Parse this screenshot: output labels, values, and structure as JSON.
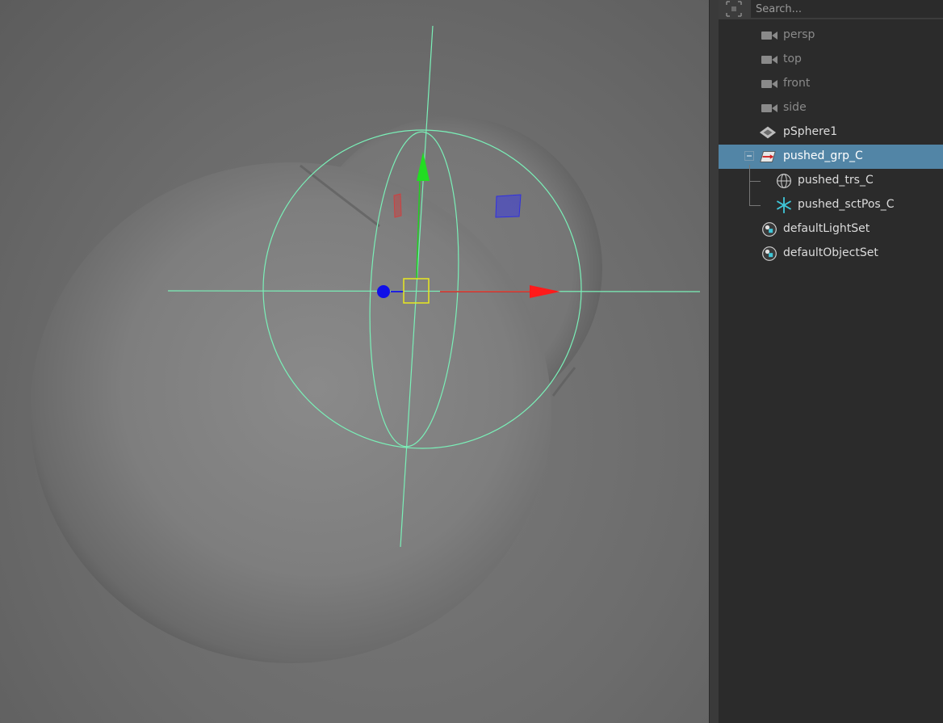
{
  "search": {
    "placeholder": "Search..."
  },
  "outliner": {
    "items": [
      {
        "label": "persp",
        "icon": "camera-icon",
        "dim": true
      },
      {
        "label": "top",
        "icon": "camera-icon",
        "dim": true
      },
      {
        "label": "front",
        "icon": "camera-icon",
        "dim": true
      },
      {
        "label": "side",
        "icon": "camera-icon",
        "dim": true
      },
      {
        "label": "pSphere1",
        "icon": "mesh-icon",
        "dim": false
      },
      {
        "label": "pushed_grp_C",
        "icon": "group-icon",
        "selected": true,
        "expanded": true
      },
      {
        "label": "pushed_trs_C",
        "icon": "sphere-globe-icon",
        "child": true
      },
      {
        "label": "pushed_sctPos_C",
        "icon": "asterisk-icon",
        "child": true
      },
      {
        "label": "defaultLightSet",
        "icon": "set-icon"
      },
      {
        "label": "defaultObjectSet",
        "icon": "set-icon"
      }
    ]
  },
  "colors": {
    "selection": "#5285a6",
    "manipulator_x": "#ff2020",
    "manipulator_y": "#20d020",
    "manipulator_z": "#1010e0",
    "wire": "#7af0b8",
    "center_box": "#e8e820"
  }
}
